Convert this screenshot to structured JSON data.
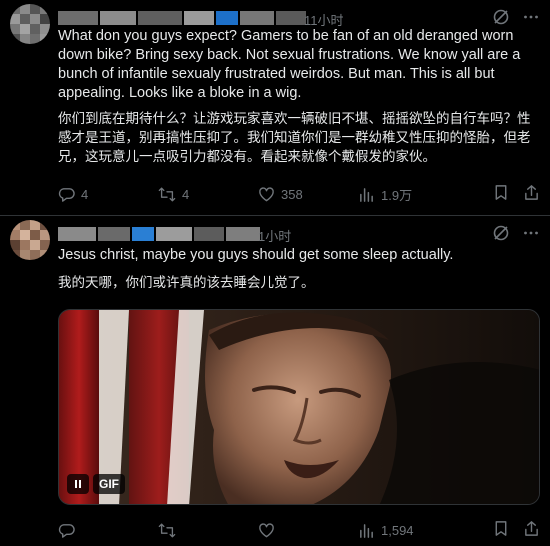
{
  "tweets": [
    {
      "time": "11小时",
      "text_en": "What don you guys expect?  Gamers to be fan of an old deranged worn down bike? Bring sexy back. Not sexual frustrations.  We know yall are a bunch of infantile sexualy frustrated weirdos. But man.  This is all but appealing.  Looks like a bloke in a wig.",
      "text_zh": "你们到底在期待什么？让游戏玩家喜欢一辆破旧不堪、摇摇欲坠的自行车吗？性感才是王道，别再搞性压抑了。我们知道你们是一群幼稚又性压抑的怪胎，但老兄，这玩意儿一点吸引力都没有。看起来就像个戴假发的家伙。",
      "actions": {
        "replies": "4",
        "retweets": "4",
        "likes": "358",
        "views": "1.9万"
      }
    },
    {
      "time": "1小时",
      "text_en": "Jesus christ, maybe you guys should get some sleep actually.",
      "text_zh": "我的天哪，你们或许真的该去睡会儿觉了。",
      "media": {
        "badge": "GIF"
      },
      "actions": {
        "replies": "",
        "retweets": "",
        "likes": "",
        "views": "1,594"
      }
    }
  ],
  "icons": {
    "top": [
      "grok-icon",
      "more-icon"
    ],
    "actions": [
      "reply-icon",
      "retweet-icon",
      "like-icon",
      "views-icon",
      "bookmark-icon",
      "share-icon"
    ]
  },
  "colors": {
    "background": "#000000",
    "text": "#e7e9ea",
    "secondary": "#71767b",
    "divider": "#2f3336"
  }
}
